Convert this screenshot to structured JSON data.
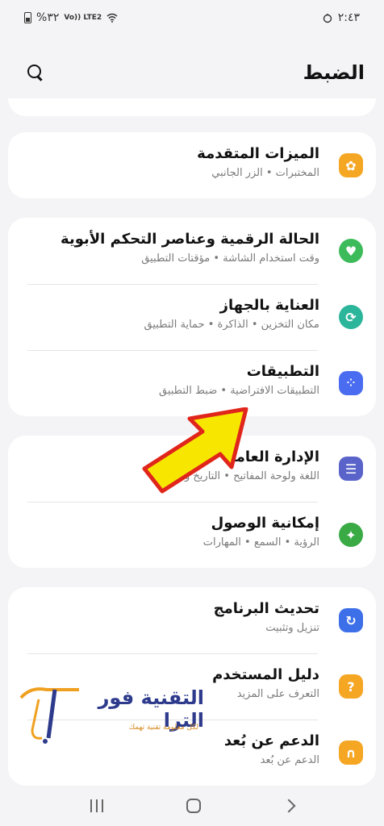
{
  "status_bar": {
    "time": "٢:٤٣",
    "battery": "%٣٢",
    "network": "Vo)) LTE2"
  },
  "header": {
    "title": "الضبط",
    "search_icon": "search-icon"
  },
  "groups": [
    {
      "items": [
        {
          "title": "الميزات المتقدمة",
          "subtitle": "المختبرات  •  الزر الجانبي",
          "icon": "gear-icon",
          "color": "#f5a623"
        }
      ]
    },
    {
      "items": [
        {
          "title": "الحالة الرقمية وعناصر التحكم الأبوية",
          "subtitle": "وقت استخدام الشاشة  •  مؤقتات التطبيق",
          "icon": "heart-icon",
          "color": "#3dbb5a"
        },
        {
          "title": "العناية بالجهاز",
          "subtitle": "مكان التخزين  •  الذاكرة  •  حماية التطبيق",
          "icon": "refresh-icon",
          "color": "#2bb59a"
        },
        {
          "title": "التطبيقات",
          "subtitle": "التطبيقات الافتراضية  •  ضبط التطبيق",
          "icon": "grid-icon",
          "color": "#4a6cf0"
        }
      ]
    },
    {
      "items": [
        {
          "title": "الإدارة العامة",
          "subtitle": "اللغة ولوحة المفاتيح  •  التاريخ والوقت",
          "icon": "sliders-icon",
          "color": "#5a63c9"
        },
        {
          "title": "إمكانية الوصول",
          "subtitle": "الرؤية  •  السمع  •  المهارات",
          "icon": "accessibility-icon",
          "color": "#3aaa45"
        }
      ]
    },
    {
      "items": [
        {
          "title": "تحديث البرنامج",
          "subtitle": "تنزيل وتثبيت",
          "icon": "update-icon",
          "color": "#3d6fe8"
        },
        {
          "title": "دليل المستخدم",
          "subtitle": "التعرف على المزيد",
          "icon": "manual-icon",
          "color": "#f5a623"
        },
        {
          "title": "الدعم عن بُعد",
          "subtitle": "الدعم عن بُعد",
          "icon": "headset-icon",
          "color": "#f5a623"
        }
      ]
    }
  ],
  "watermark": {
    "text": "التقنية فور الترا",
    "tagline": "لكل معلومة تقنية تهمك"
  }
}
